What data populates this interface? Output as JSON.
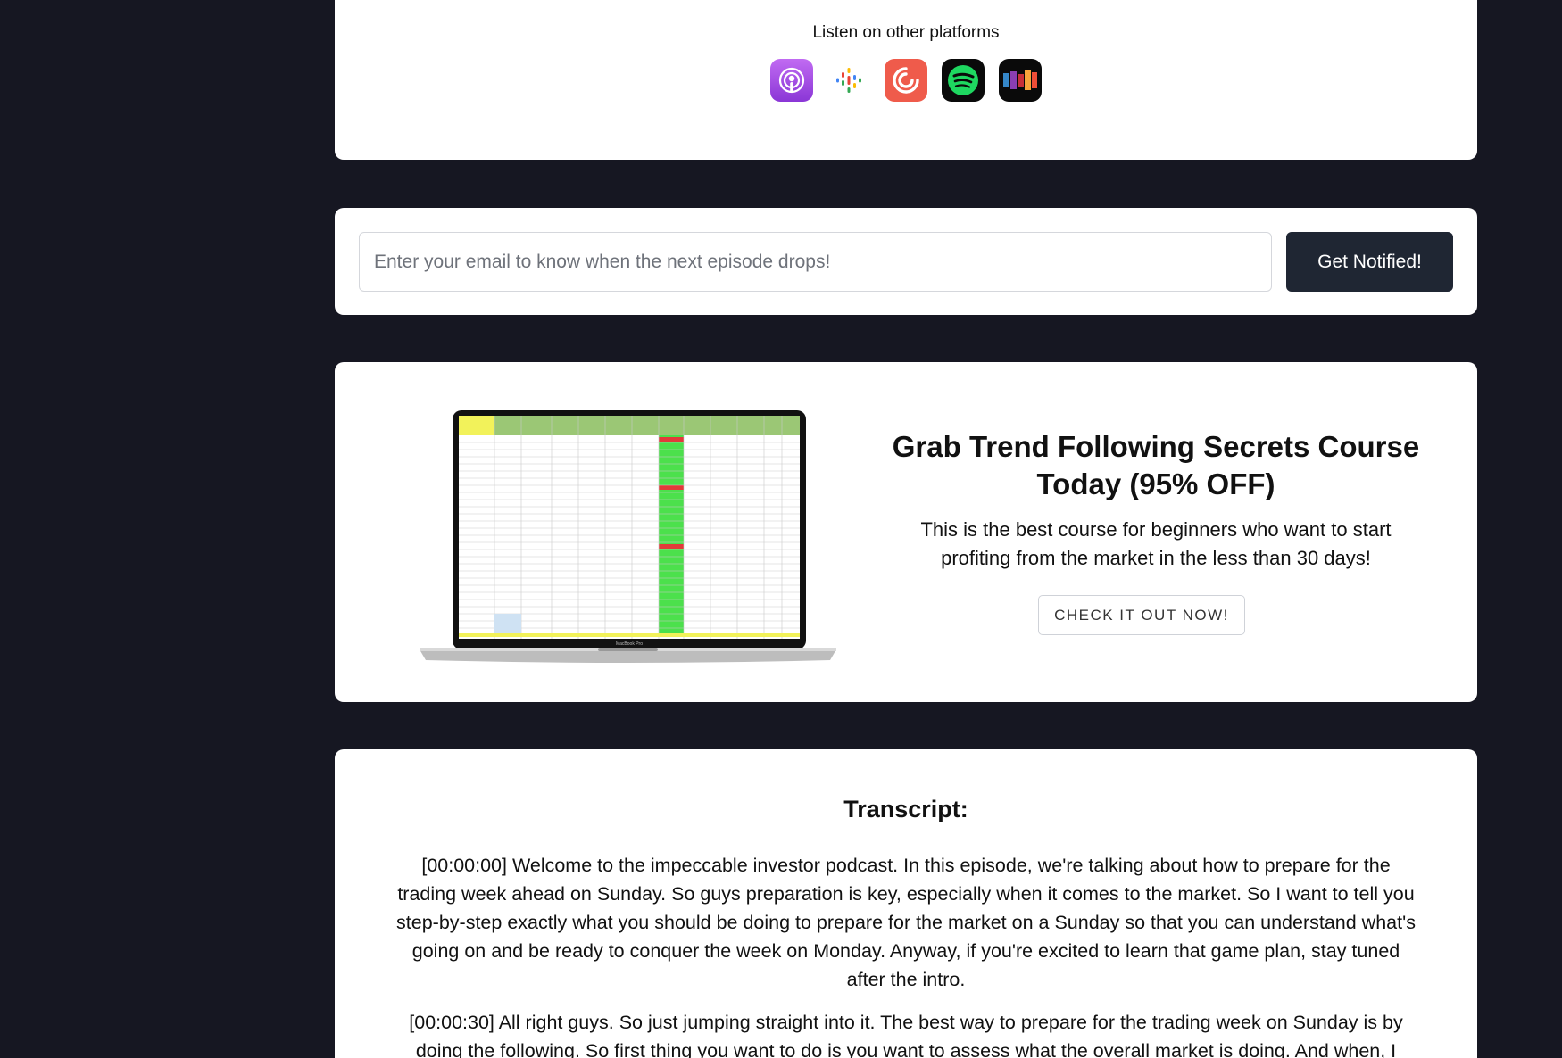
{
  "platforms": {
    "title": "Listen on other platforms",
    "icons": [
      "apple-podcasts-icon",
      "google-podcasts-icon",
      "pocket-casts-icon",
      "spotify-icon",
      "stitcher-icon"
    ],
    "colors": {
      "apple": "#9b4ce0",
      "pocket": "#ef5b4b",
      "spotify": "#1ed760",
      "dark": "#0a0a0a"
    }
  },
  "subscribe": {
    "email_placeholder": "Enter your email to know when the next episode drops!",
    "email_value": "",
    "button_label": "Get Notified!"
  },
  "course": {
    "title": "Grab Trend Following Secrets Course Today (95% OFF)",
    "description": "This is the best course for beginners who want to start profiting from the market in the less than 30 days!",
    "button_label": "CHECK IT OUT NOW!",
    "laptop_caption": "MacBook Pro"
  },
  "transcript": {
    "title": "Transcript:",
    "paragraphs": [
      "[00:00:00] Welcome to the impeccable investor podcast. In this episode, we're talking about how to prepare for the trading week ahead on Sunday. So guys preparation is key, especially when it comes to the market. So I want to tell you step-by-step exactly what you should be doing to prepare for the market on a Sunday so that you can understand what's going on and be ready to conquer the week on Monday. Anyway, if you're excited to learn that game plan, stay tuned after the intro.",
      "[00:00:30] All right guys. So just jumping straight into it. The best way to prepare for the trading week on Sunday is by doing the following. So first thing you want to do is you want to assess what the overall market is doing. And when, I"
    ]
  },
  "theme": {
    "page_bg": "#161722",
    "button_dark": "#1f2633"
  }
}
